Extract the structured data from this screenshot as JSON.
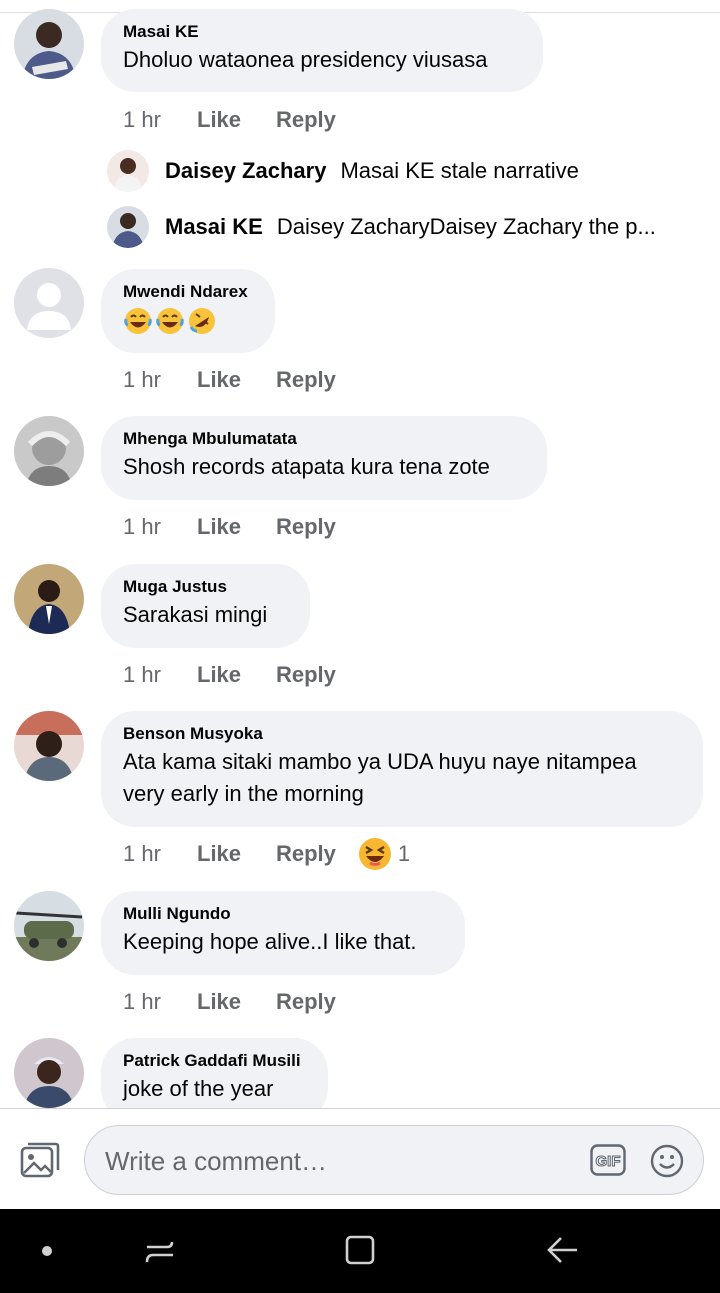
{
  "comments": [
    {
      "author": "Masai KE",
      "text": "Dholuo wataonea presidency viusasa",
      "time": "1 hr",
      "like": "Like",
      "reply": "Reply"
    },
    {
      "author": "Mwendi Ndarex",
      "text": "",
      "time": "1 hr",
      "like": "Like",
      "reply": "Reply"
    },
    {
      "author": "Mhenga Mbulumatata",
      "text": "Shosh records atapata kura tena zote",
      "time": "1 hr",
      "like": "Like",
      "reply": "Reply"
    },
    {
      "author": "Muga Justus",
      "text": "Sarakasi  mingi",
      "time": "1 hr",
      "like": "Like",
      "reply": "Reply"
    },
    {
      "author": "Benson Musyoka",
      "text": "Ata kama sitaki mambo ya UDA huyu naye nitampea very early in the morning",
      "time": "1 hr",
      "like": "Like",
      "reply": "Reply",
      "reaction_count": "1"
    },
    {
      "author": "Mulli Ngundo",
      "text": "Keeping hope alive..I like that.",
      "time": "1 hr",
      "like": "Like",
      "reply": "Reply"
    },
    {
      "author": "Patrick Gaddafi Musili",
      "text": "joke of the year"
    }
  ],
  "replies": [
    {
      "author": "Daisey Zachary",
      "text": "Masai KE stale narrative"
    },
    {
      "author": "Masai KE",
      "text": "Daisey ZacharyDaisey Zachary the p..."
    }
  ],
  "emoji_reaction_icons": [
    "laughing-tears-icon",
    "laughing-tears-icon",
    "rolling-laughing-icon"
  ],
  "composer": {
    "placeholder": "Write a comment…",
    "gif_label": "GIF"
  },
  "colors": {
    "bubble": "#f0f2f5",
    "secondary_text": "#65676b",
    "primary_text": "#050505",
    "navbar": "#000000"
  }
}
